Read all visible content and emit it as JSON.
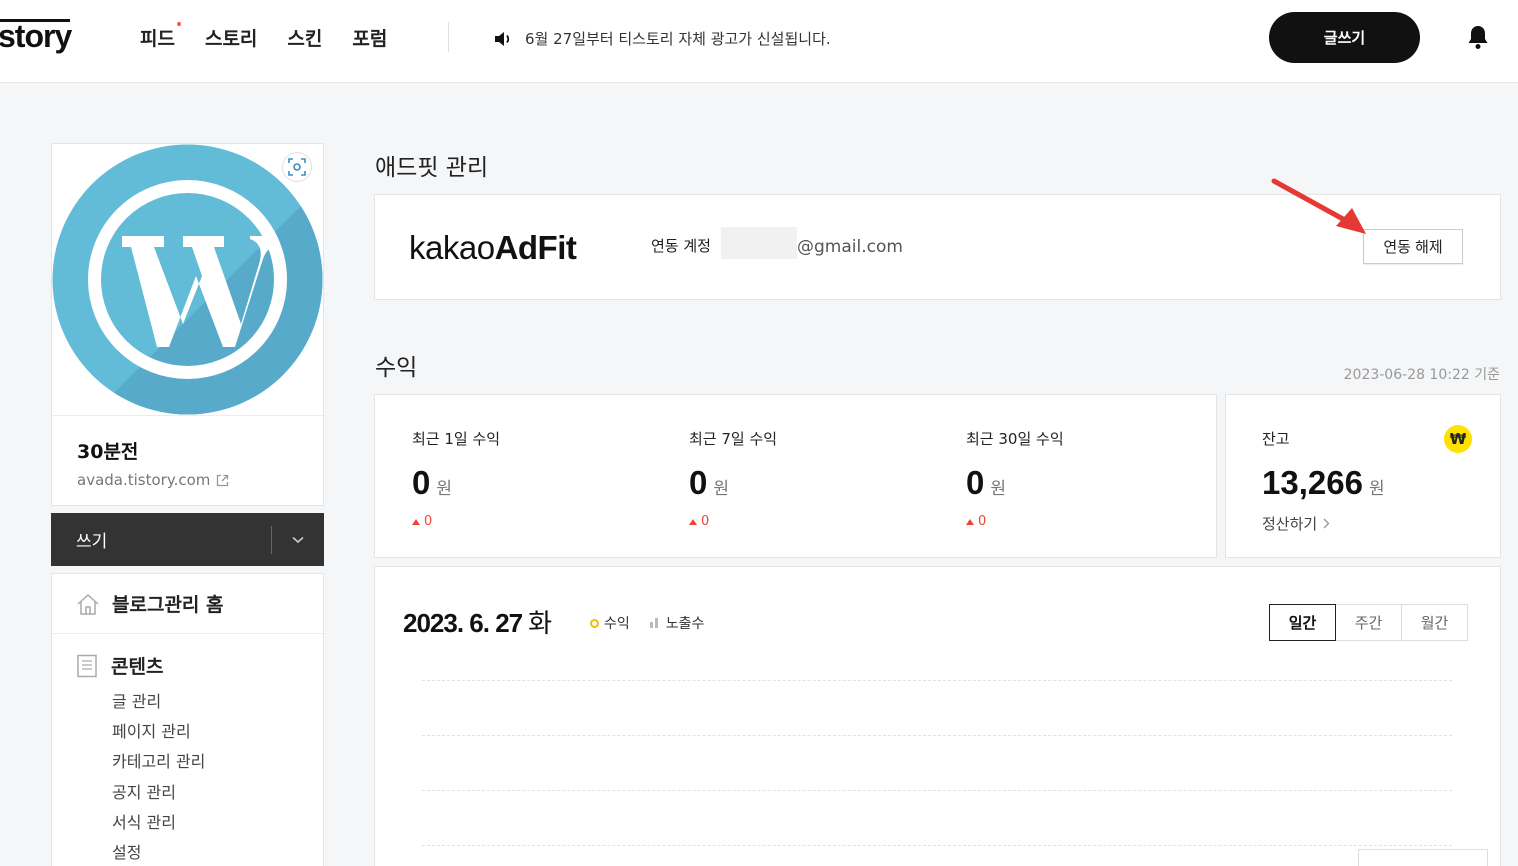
{
  "header": {
    "logo": "story",
    "nav": [
      "피드",
      "스토리",
      "스킨",
      "포럼"
    ],
    "notice": "6월 27일부터 티스토리 자체 광고가 신설됩니다.",
    "write_button": "글쓰기"
  },
  "sidebar": {
    "blog_name": "30분전",
    "blog_url": "avada.tistory.com",
    "write_label": "쓰기",
    "home_label": "블로그관리 홈",
    "content_label": "콘텐츠",
    "content_items": [
      "글 관리",
      "페이지 관리",
      "카테고리 관리",
      "공지 관리",
      "서식 관리",
      "설정"
    ]
  },
  "adfit": {
    "title": "애드핏 관리",
    "logo_light": "kakao",
    "logo_bold": "AdFit",
    "account_label": "연동 계정",
    "email_suffix": "@gmail.com",
    "unlink_button": "연동 해제"
  },
  "revenue": {
    "title": "수익",
    "as_of": "2023-06-28 10:22 기준",
    "stats": [
      {
        "label": "최근 1일 수익",
        "value": "0",
        "unit": "원",
        "delta": "0"
      },
      {
        "label": "최근 7일 수익",
        "value": "0",
        "unit": "원",
        "delta": "0"
      },
      {
        "label": "최근 30일 수익",
        "value": "0",
        "unit": "원",
        "delta": "0"
      }
    ],
    "balance": {
      "label": "잔고",
      "value": "13,266",
      "unit": "원",
      "settle_link": "정산하기",
      "badge": "₩"
    }
  },
  "chart": {
    "date": "2023. 6. 27",
    "weekday": "화",
    "legend_revenue": "수익",
    "legend_impressions": "노출수",
    "tabs": [
      "일간",
      "주간",
      "월간"
    ],
    "active_tab": "일간"
  },
  "colors": {
    "accent_dark": "#111111",
    "delta_up": "#ee4433",
    "won_badge": "#ffe100",
    "arrow": "#e53935"
  }
}
